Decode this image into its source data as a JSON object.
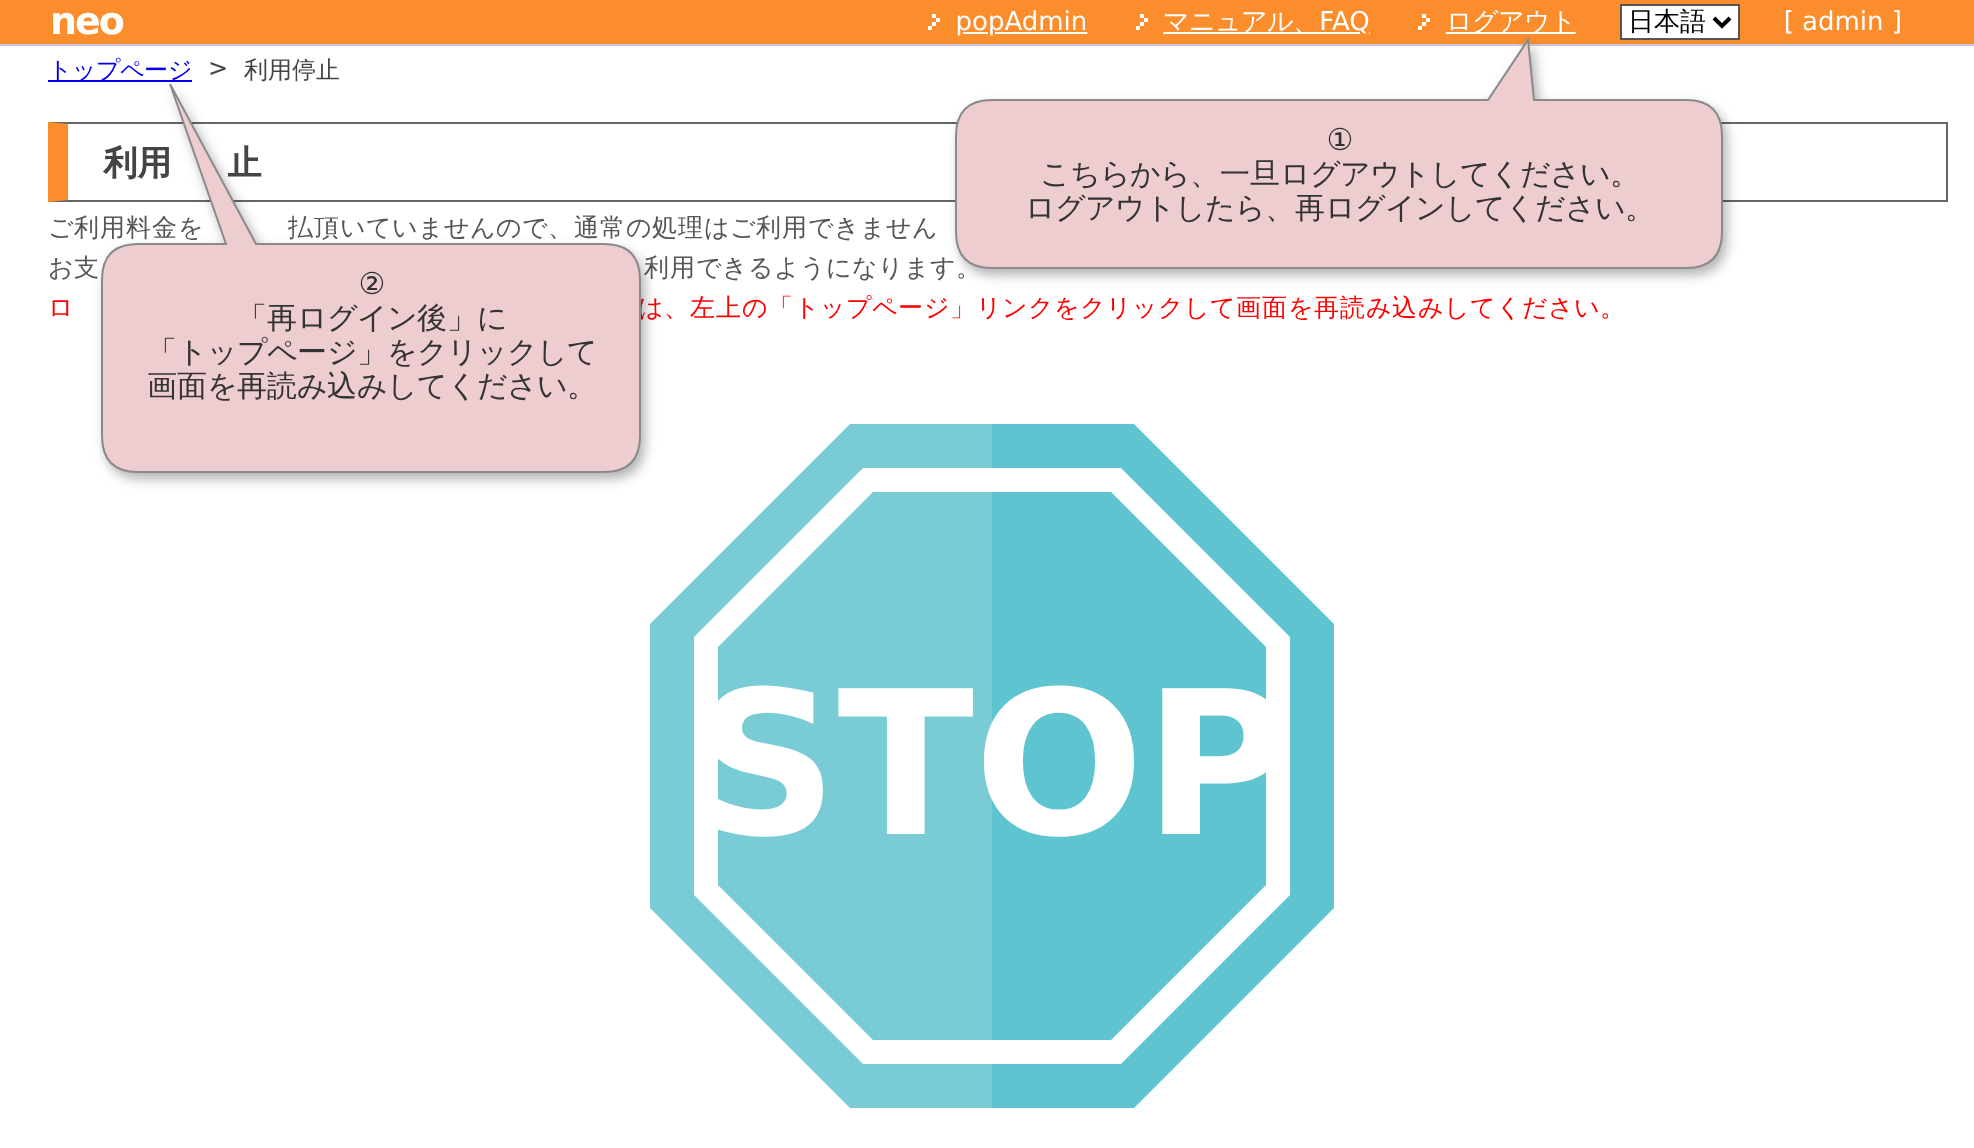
{
  "header": {
    "logo": "neo",
    "nav_links": [
      {
        "label": "popAdmin"
      },
      {
        "label": "マニュアル、FAQ"
      },
      {
        "label": "ログアウト"
      }
    ],
    "language": "日本語",
    "user": "[ admin ]"
  },
  "breadcrumb": {
    "link": "トップページ",
    "separator": ">",
    "current": "利用停止"
  },
  "page_title": [
    "利用",
    "止"
  ],
  "message_lines": [
    {
      "kind": "normal",
      "fragments": [
        "ご利用料金を",
        "払頂いていませんので、通常の処理はご利用できません"
      ]
    },
    {
      "kind": "normal",
      "fragments": [
        "お支",
        "利用できるようになります。"
      ]
    },
    {
      "kind": "warning",
      "fragments": [
        "ロ",
        "は、左上の「トップページ」リンクをクリックして画面を再読み込みしてください。"
      ]
    }
  ],
  "stop_sign": {
    "text": "STOP"
  },
  "callouts": [
    {
      "lines": [
        "①",
        "こちらから、一旦ログアウトしてください。",
        "ログアウトしたら、再ログインしてください。"
      ]
    },
    {
      "lines": [
        "②",
        "「再ログイン後」に",
        "「トップページ」をクリックして",
        "画面を再読み込みしてください。"
      ]
    }
  ]
}
